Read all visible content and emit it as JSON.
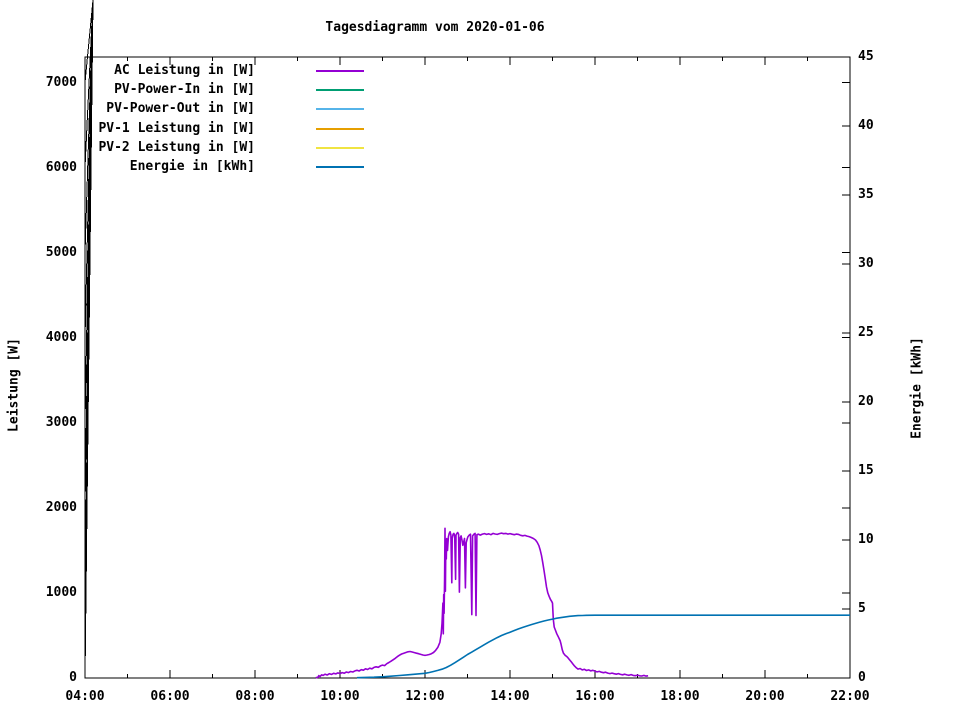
{
  "chart_data": {
    "type": "line",
    "title": "Tagesdiagramm vom 2020-01-06",
    "grid": false,
    "legend_position": "top-left",
    "x_axis": {
      "range_hours": [
        4,
        22
      ],
      "major_ticks": [
        {
          "h": 4,
          "label": "04:00"
        },
        {
          "h": 6,
          "label": "06:00"
        },
        {
          "h": 8,
          "label": "08:00"
        },
        {
          "h": 10,
          "label": "10:00"
        },
        {
          "h": 12,
          "label": "12:00"
        },
        {
          "h": 14,
          "label": "14:00"
        },
        {
          "h": 16,
          "label": "16:00"
        },
        {
          "h": 18,
          "label": "18:00"
        },
        {
          "h": 20,
          "label": "20:00"
        },
        {
          "h": 22,
          "label": "22:00"
        }
      ],
      "minor_tick_hours": [
        5,
        7,
        9,
        11,
        13,
        15,
        17,
        19,
        21
      ]
    },
    "y_axis": {
      "label": "Leistung [W]",
      "range": [
        0,
        7300
      ],
      "ticks": [
        {
          "v": 0,
          "label": "0"
        },
        {
          "v": 1000,
          "label": "1000"
        },
        {
          "v": 2000,
          "label": "2000"
        },
        {
          "v": 3000,
          "label": "3000"
        },
        {
          "v": 4000,
          "label": "4000"
        },
        {
          "v": 5000,
          "label": "5000"
        },
        {
          "v": 6000,
          "label": "6000"
        },
        {
          "v": 7000,
          "label": "7000"
        }
      ]
    },
    "y2_axis": {
      "label": "Energie [kWh]",
      "range": [
        0,
        45
      ],
      "ticks": [
        {
          "v": 0,
          "label": "0"
        },
        {
          "v": 5,
          "label": "5"
        },
        {
          "v": 10,
          "label": "10"
        },
        {
          "v": 15,
          "label": "15"
        },
        {
          "v": 20,
          "label": "20"
        },
        {
          "v": 25,
          "label": "25"
        },
        {
          "v": 30,
          "label": "30"
        },
        {
          "v": 35,
          "label": "35"
        },
        {
          "v": 40,
          "label": "40"
        },
        {
          "v": 45,
          "label": "45"
        }
      ]
    },
    "series": [
      {
        "name": "AC Leistung in [W]",
        "color": "#9400d3",
        "axis": "y",
        "points": [
          [
            9.43,
            4
          ],
          [
            9.48,
            8
          ],
          [
            9.5,
            28
          ],
          [
            9.53,
            18
          ],
          [
            9.57,
            38
          ],
          [
            9.6,
            30
          ],
          [
            9.65,
            45
          ],
          [
            9.7,
            35
          ],
          [
            9.75,
            50
          ],
          [
            9.8,
            42
          ],
          [
            9.85,
            55
          ],
          [
            9.9,
            48
          ],
          [
            9.95,
            60
          ],
          [
            10.0,
            52
          ],
          [
            10.05,
            64
          ],
          [
            10.1,
            57
          ],
          [
            10.15,
            70
          ],
          [
            10.2,
            63
          ],
          [
            10.25,
            76
          ],
          [
            10.3,
            70
          ],
          [
            10.35,
            84
          ],
          [
            10.4,
            90
          ],
          [
            10.45,
            82
          ],
          [
            10.5,
            98
          ],
          [
            10.55,
            92
          ],
          [
            10.6,
            108
          ],
          [
            10.65,
            100
          ],
          [
            10.7,
            115
          ],
          [
            10.75,
            108
          ],
          [
            10.8,
            125
          ],
          [
            10.85,
            132
          ],
          [
            10.9,
            126
          ],
          [
            10.95,
            142
          ],
          [
            11.0,
            152
          ],
          [
            11.05,
            146
          ],
          [
            11.1,
            168
          ],
          [
            11.15,
            182
          ],
          [
            11.2,
            198
          ],
          [
            11.25,
            214
          ],
          [
            11.3,
            232
          ],
          [
            11.35,
            252
          ],
          [
            11.4,
            268
          ],
          [
            11.45,
            282
          ],
          [
            11.5,
            292
          ],
          [
            11.55,
            300
          ],
          [
            11.6,
            308
          ],
          [
            11.65,
            312
          ],
          [
            11.7,
            306
          ],
          [
            11.75,
            298
          ],
          [
            11.8,
            292
          ],
          [
            11.85,
            286
          ],
          [
            11.9,
            278
          ],
          [
            11.95,
            270
          ],
          [
            12.0,
            266
          ],
          [
            12.05,
            270
          ],
          [
            12.1,
            276
          ],
          [
            12.15,
            286
          ],
          [
            12.2,
            300
          ],
          [
            12.25,
            325
          ],
          [
            12.3,
            360
          ],
          [
            12.35,
            420
          ],
          [
            12.38,
            520
          ],
          [
            12.4,
            640
          ],
          [
            12.42,
            880
          ],
          [
            12.43,
            520
          ],
          [
            12.44,
            980
          ],
          [
            12.45,
            760
          ],
          [
            12.46,
            1180
          ],
          [
            12.47,
            1760
          ],
          [
            12.48,
            1020
          ],
          [
            12.49,
            1560
          ],
          [
            12.5,
            1400
          ],
          [
            12.51,
            1640
          ],
          [
            12.53,
            1500
          ],
          [
            12.55,
            1660
          ],
          [
            12.57,
            1700
          ],
          [
            12.59,
            1720
          ],
          [
            12.61,
            1680
          ],
          [
            12.63,
            1120
          ],
          [
            12.64,
            1640
          ],
          [
            12.66,
            1690
          ],
          [
            12.68,
            1700
          ],
          [
            12.7,
            1670
          ],
          [
            12.72,
            1160
          ],
          [
            12.73,
            1680
          ],
          [
            12.75,
            1700
          ],
          [
            12.77,
            1710
          ],
          [
            12.79,
            1690
          ],
          [
            12.81,
            1010
          ],
          [
            12.83,
            1650
          ],
          [
            12.85,
            1670
          ],
          [
            12.87,
            1620
          ],
          [
            12.89,
            1560
          ],
          [
            12.91,
            1600
          ],
          [
            12.93,
            1640
          ],
          [
            12.95,
            1060
          ],
          [
            12.97,
            1590
          ],
          [
            12.99,
            1630
          ],
          [
            13.01,
            1660
          ],
          [
            13.04,
            1680
          ],
          [
            13.07,
            1690
          ],
          [
            13.1,
            745
          ],
          [
            13.12,
            1670
          ],
          [
            13.15,
            1690
          ],
          [
            13.18,
            1700
          ],
          [
            13.2,
            735
          ],
          [
            13.22,
            1685
          ],
          [
            13.26,
            1690
          ],
          [
            13.3,
            1680
          ],
          [
            13.35,
            1692
          ],
          [
            13.4,
            1698
          ],
          [
            13.45,
            1688
          ],
          [
            13.5,
            1695
          ],
          [
            13.55,
            1685
          ],
          [
            13.6,
            1700
          ],
          [
            13.65,
            1693
          ],
          [
            13.7,
            1688
          ],
          [
            13.75,
            1698
          ],
          [
            13.8,
            1703
          ],
          [
            13.85,
            1696
          ],
          [
            13.9,
            1700
          ],
          [
            13.95,
            1692
          ],
          [
            14.0,
            1698
          ],
          [
            14.05,
            1690
          ],
          [
            14.1,
            1684
          ],
          [
            14.15,
            1692
          ],
          [
            14.2,
            1688
          ],
          [
            14.25,
            1678
          ],
          [
            14.3,
            1672
          ],
          [
            14.35,
            1676
          ],
          [
            14.4,
            1668
          ],
          [
            14.45,
            1662
          ],
          [
            14.5,
            1652
          ],
          [
            14.55,
            1640
          ],
          [
            14.6,
            1622
          ],
          [
            14.64,
            1595
          ],
          [
            14.68,
            1555
          ],
          [
            14.71,
            1505
          ],
          [
            14.74,
            1440
          ],
          [
            14.77,
            1360
          ],
          [
            14.8,
            1265
          ],
          [
            14.83,
            1165
          ],
          [
            14.86,
            1070
          ],
          [
            14.89,
            1000
          ],
          [
            14.92,
            960
          ],
          [
            14.95,
            925
          ],
          [
            14.98,
            900
          ],
          [
            15.0,
            880
          ],
          [
            15.02,
            690
          ],
          [
            15.04,
            600
          ],
          [
            15.07,
            560
          ],
          [
            15.1,
            520
          ],
          [
            15.14,
            480
          ],
          [
            15.18,
            440
          ],
          [
            15.2,
            400
          ],
          [
            15.23,
            330
          ],
          [
            15.26,
            290
          ],
          [
            15.3,
            265
          ],
          [
            15.33,
            255
          ],
          [
            15.36,
            240
          ],
          [
            15.4,
            215
          ],
          [
            15.44,
            190
          ],
          [
            15.48,
            165
          ],
          [
            15.52,
            140
          ],
          [
            15.56,
            120
          ],
          [
            15.6,
            105
          ],
          [
            15.65,
            112
          ],
          [
            15.7,
            95
          ],
          [
            15.75,
            102
          ],
          [
            15.8,
            88
          ],
          [
            15.85,
            95
          ],
          [
            15.9,
            84
          ],
          [
            15.95,
            90
          ],
          [
            16.0,
            80
          ],
          [
            16.05,
            72
          ],
          [
            16.1,
            78
          ],
          [
            16.15,
            68
          ],
          [
            16.2,
            62
          ],
          [
            16.25,
            68
          ],
          [
            16.3,
            58
          ],
          [
            16.35,
            52
          ],
          [
            16.4,
            58
          ],
          [
            16.45,
            50
          ],
          [
            16.5,
            45
          ],
          [
            16.55,
            52
          ],
          [
            16.6,
            42
          ],
          [
            16.65,
            38
          ],
          [
            16.7,
            45
          ],
          [
            16.75,
            36
          ],
          [
            16.8,
            32
          ],
          [
            16.85,
            40
          ],
          [
            16.9,
            30
          ],
          [
            16.95,
            27
          ],
          [
            17.0,
            34
          ],
          [
            17.05,
            26
          ],
          [
            17.1,
            23
          ],
          [
            17.15,
            30
          ],
          [
            17.2,
            22
          ],
          [
            17.25,
            26
          ]
        ]
      },
      {
        "name": "PV-Power-In in [W]",
        "color": "#009e73",
        "axis": "y",
        "points": []
      },
      {
        "name": "PV-Power-Out in [W]",
        "color": "#56b4e9",
        "axis": "y",
        "points": []
      },
      {
        "name": "PV-1 Leistung in [W]",
        "color": "#e69f00",
        "axis": "y",
        "points": []
      },
      {
        "name": "PV-2 Leistung in [W]",
        "color": "#f0e442",
        "axis": "y",
        "points": []
      },
      {
        "name": "Energie in [kWh]",
        "color": "#0072b2",
        "axis": "y2",
        "points": [
          [
            10.4,
            0.02
          ],
          [
            10.6,
            0.04
          ],
          [
            10.8,
            0.06
          ],
          [
            11.0,
            0.09
          ],
          [
            11.2,
            0.13
          ],
          [
            11.4,
            0.18
          ],
          [
            11.6,
            0.23
          ],
          [
            11.8,
            0.28
          ],
          [
            12.0,
            0.34
          ],
          [
            12.1,
            0.4
          ],
          [
            12.2,
            0.47
          ],
          [
            12.3,
            0.55
          ],
          [
            12.4,
            0.64
          ],
          [
            12.5,
            0.76
          ],
          [
            12.6,
            0.92
          ],
          [
            12.7,
            1.1
          ],
          [
            12.8,
            1.3
          ],
          [
            12.9,
            1.5
          ],
          [
            13.0,
            1.7
          ],
          [
            13.1,
            1.88
          ],
          [
            13.2,
            2.06
          ],
          [
            13.3,
            2.24
          ],
          [
            13.4,
            2.42
          ],
          [
            13.5,
            2.6
          ],
          [
            13.6,
            2.77
          ],
          [
            13.7,
            2.93
          ],
          [
            13.8,
            3.08
          ],
          [
            13.9,
            3.2
          ],
          [
            14.0,
            3.32
          ],
          [
            14.1,
            3.44
          ],
          [
            14.2,
            3.56
          ],
          [
            14.3,
            3.67
          ],
          [
            14.4,
            3.77
          ],
          [
            14.5,
            3.87
          ],
          [
            14.6,
            3.96
          ],
          [
            14.7,
            4.05
          ],
          [
            14.8,
            4.13
          ],
          [
            14.9,
            4.2
          ],
          [
            15.0,
            4.27
          ],
          [
            15.1,
            4.33
          ],
          [
            15.2,
            4.38
          ],
          [
            15.3,
            4.43
          ],
          [
            15.4,
            4.47
          ],
          [
            15.5,
            4.5
          ],
          [
            15.6,
            4.52
          ],
          [
            15.7,
            4.53
          ],
          [
            15.8,
            4.54
          ],
          [
            16.0,
            4.55
          ],
          [
            16.5,
            4.55
          ],
          [
            17.0,
            4.55
          ],
          [
            18.0,
            4.55
          ],
          [
            19.0,
            4.55
          ],
          [
            20.0,
            4.55
          ],
          [
            21.0,
            4.55
          ],
          [
            22.0,
            4.55
          ]
        ]
      }
    ]
  }
}
